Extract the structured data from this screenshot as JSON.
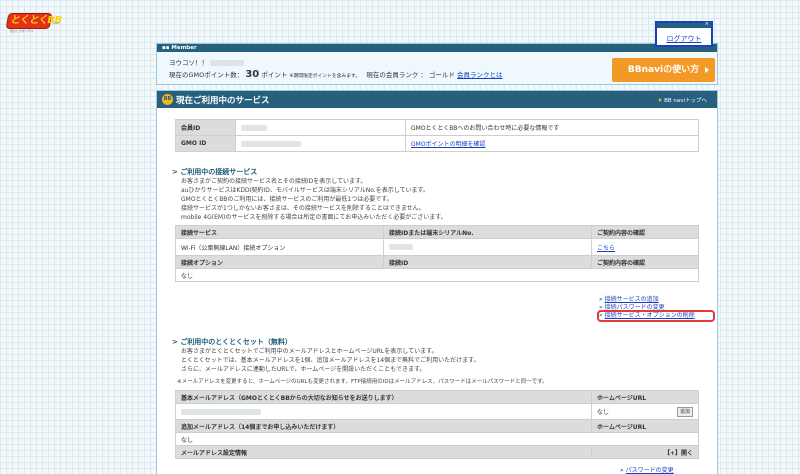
{
  "logo": {
    "text": "とくとくBB",
    "sub": "安心とクオリティ",
    "com": ".com"
  },
  "member": {
    "header": "Member",
    "greeting": "ヨウコソ！！",
    "points_label": "現在のGMOポイント数：",
    "points_value": "30",
    "points_unit": "ポイント",
    "points_note": "※期間限定ポイントを含みます。",
    "rank_label": "現在の会員ランク ： ゴールド",
    "rank_link": "会員ランクとは",
    "navi_button": "BBnaviの使い方"
  },
  "logout": {
    "label": "ログアウト",
    "close": "×"
  },
  "main": {
    "icon": "BB",
    "title": "現在ご利用中のサービス",
    "nav_link": "BB naviトップへ",
    "id_table": [
      {
        "label": "会員ID",
        "desc": "GMOとくとくBBへのお問い合わせ時に必要な情報です",
        "link": ""
      },
      {
        "label": "GMO ID",
        "desc": "",
        "link": "GMOポイントの明細を確認"
      }
    ],
    "svc_title": "ご利用中の接続サービス",
    "svc_text": [
      "お客さまがご契約の接続サービス名とその接続IDを表示しています。",
      "auひかりサービスはKDDI契約ID、モバイルサービスは端末シリアルNo.を表示しています。",
      "GMOとくとくBBのご利用には、接続サービスのご利用が最低1つは必要です。",
      "接続サービスが1つしかないお客さまは、その接続サービスを削除することはできません。",
      "mobile 4G(EM)のサービスを削除する場合は所定の書面にてお申込みいただく必要がございます。"
    ],
    "svc_headers": [
      "接続サービス",
      "接続IDまたは端末シリアルNo.",
      "ご契約内容の確認"
    ],
    "svc_row": {
      "name": "Wi-Fi（公衆無線LAN）接続オプション",
      "link": "こちら"
    },
    "opt_headers": [
      "接続オプション",
      "接続ID",
      "ご契約内容の確認"
    ],
    "opt_row": "なし",
    "svc_links": [
      "接続サービスの追加",
      "接続パスワードの変更",
      "接続サービス・オプションの削除"
    ],
    "set_title": "ご利用中のとくとくセット（無料）",
    "set_text": [
      "お客さまがとくとくセットでご利用中のメールアドレスとホームページURLを表示しています。",
      "とくとくセットでは、基本メールアドレスを1個、追加メールアドレスを14個まで無料でご利用いただけます。",
      "さらに、メールアドレスに連動したURLで、ホームページを開設いただくこともできます。"
    ],
    "set_note": "※メールアドレスを変更すると、ホームページのURLも変更されます。FTP接続用のIDはメールアドレス、パスワードはメールパスワードと同一です。",
    "basic_mail_header": "基本メールアドレス（GMOとくとくBBからの大切なお知らせをお送りします）",
    "homepage_header": "ホームページURL",
    "basic_hp_value": "なし",
    "add_button": "追加",
    "extra_mail_header": "追加メールアドレス（14個までお申し込みいただけます）",
    "extra_hp_header": "ホームページURL",
    "extra_value": "なし",
    "mail_settings": "メールアドレス設定情報",
    "mail_settings_toggle": "【+】開く",
    "pw_link": "パスワードの変更"
  }
}
